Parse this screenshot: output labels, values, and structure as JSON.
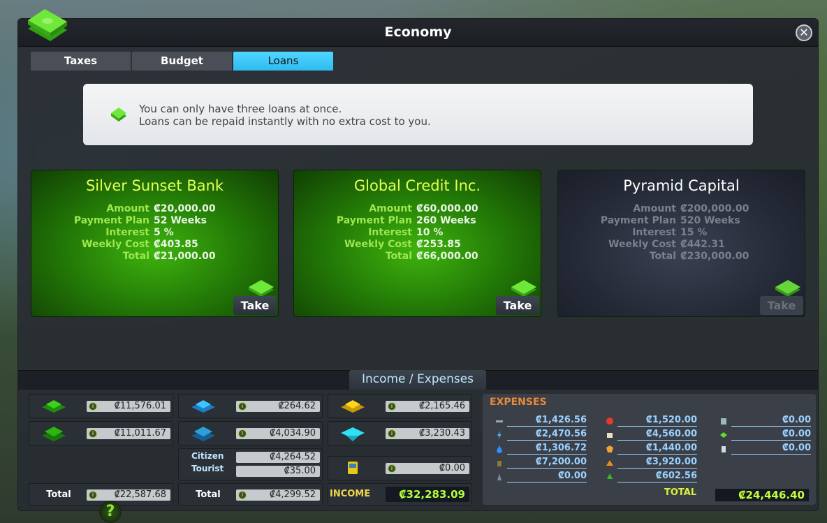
{
  "window": {
    "title": "Economy",
    "close_glyph": "✕"
  },
  "tabs": [
    {
      "label": "Taxes",
      "active": false
    },
    {
      "label": "Budget",
      "active": false
    },
    {
      "label": "Loans",
      "active": true
    }
  ],
  "info": {
    "line1": "You can only have three loans at once.",
    "line2": "Loans can be repaid instantly with no extra cost to you."
  },
  "loan_labels": {
    "amount": "Amount",
    "payment_plan": "Payment Plan",
    "interest": "Interest",
    "weekly_cost": "Weekly Cost",
    "total": "Total"
  },
  "loans": [
    {
      "bank": "Silver Sunset Bank",
      "amount": "₡20,000.00",
      "payment_plan": "52 Weeks",
      "interest": "5 %",
      "weekly_cost": "₡403.85",
      "total": "₡21,000.00",
      "button": "Take",
      "enabled": true
    },
    {
      "bank": "Global Credit Inc.",
      "amount": "₡60,000.00",
      "payment_plan": "260 Weeks",
      "interest": "10 %",
      "weekly_cost": "₡253.85",
      "total": "₡66,000.00",
      "button": "Take",
      "enabled": true
    },
    {
      "bank": "Pyramid Capital",
      "amount": "₡200,000.00",
      "payment_plan": "520 Weeks",
      "interest": "15 %",
      "weekly_cost": "₡442.31",
      "total": "₡230,000.00",
      "button": "Take",
      "enabled": false
    }
  ],
  "income_expenses": {
    "title": "Income / Expenses",
    "col1": {
      "residential_low": "₡11,576.01",
      "residential_high": "₡11,011.67",
      "total_label": "Total",
      "total": "₡22,587.68"
    },
    "col2": {
      "commercial_low": "₡264.62",
      "commercial_high": "₡4,034.90",
      "citizen_label": "Citizen",
      "citizen": "₡4,264.52",
      "tourist_label": "Tourist",
      "tourist": "₡35.00",
      "total_label": "Total",
      "total": "₡4,299.52"
    },
    "col3": {
      "industrial": "₡2,165.46",
      "office": "₡3,230.43",
      "transport": "₡0.00",
      "income_label": "INCOME",
      "income": "₡32,283.09"
    },
    "expenses": {
      "title": "EXPENSES",
      "col_a": [
        "₡1,426.56",
        "₡2,470.56",
        "₡1,306.72",
        "₡7,200.00",
        "₡0.00"
      ],
      "col_b": [
        "₡1,520.00",
        "₡4,560.00",
        "₡1,440.00",
        "₡3,920.00",
        "₡602.56"
      ],
      "col_c": [
        "₡0.00",
        "₡0.00",
        "₡0.00"
      ],
      "total_label": "TOTAL",
      "total": "₡24,446.40"
    }
  },
  "help_glyph": "?",
  "colors": {
    "accent": "#2fbbf0",
    "loan_green": "#237a07",
    "income_value": "#b5ff3a",
    "expense_title": "#e98a3a"
  }
}
